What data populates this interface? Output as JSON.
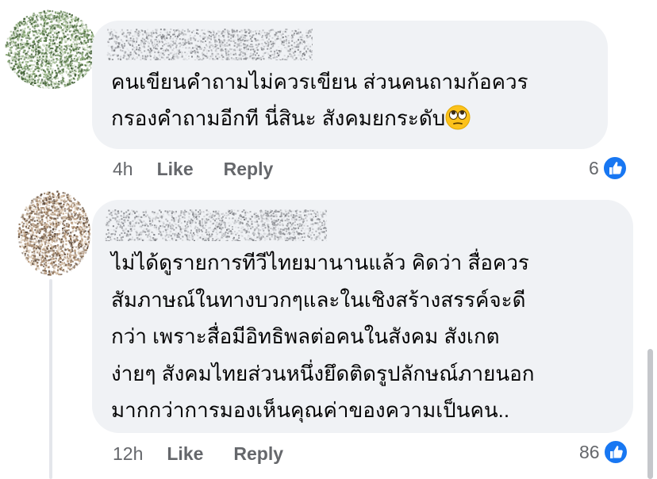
{
  "comments": [
    {
      "author": "",
      "text": "คนเขียนคำถามไม่ควรเขียน ส่วนคนถามก้อควร\nกรองคำถามอีกที นี่สินะ สังคมยกระดับ",
      "emoji": "face-with-rolling-eyes",
      "time": "4h",
      "like_label": "Like",
      "reply_label": "Reply",
      "reaction_count": "6",
      "reaction_icon": "thumbs-up-icon",
      "avatar_palette": [
        "#5a7d4a",
        "#8fae7b",
        "#3f5c34",
        "#c9d6bf"
      ]
    },
    {
      "author": "",
      "text": "ไม่ได้ดูรายการทีวีไทยมานานแล้ว คิดว่า สื่อควร\nสัมภาษณ์ในทางบวกๆและในเชิงสร้างสรรค์จะดี\nกว่า เพราะสื่อมีอิทธิพลต่อคนในสังคม สังเกต\nง่ายๆ สังคมไทยส่วนหนึ่งยึดติดรูปลักษณ์ภายนอก\nมากกว่าการมองเห็นคุณค่าของความเป็นคน..",
      "time": "12h",
      "like_label": "Like",
      "reply_label": "Reply",
      "reaction_count": "86",
      "reaction_icon": "thumbs-up-icon",
      "avatar_palette": [
        "#8a6d52",
        "#b89a7c",
        "#5e4a3a",
        "#d8c6b0"
      ]
    }
  ],
  "colors": {
    "bubble": "#f0f2f5",
    "meta_text": "#65676b",
    "like_blue": "#1877f2"
  }
}
